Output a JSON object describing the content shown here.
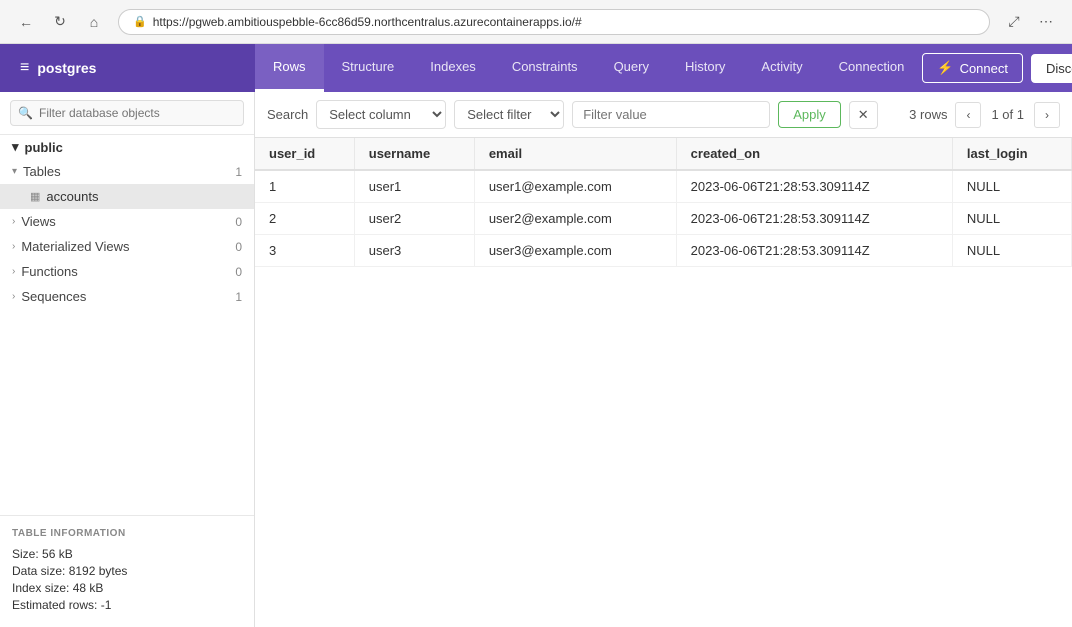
{
  "browser": {
    "url": "https://pgweb.ambitiouspebble-6cc86d59.northcentralus.azurecontainerapps.io/#",
    "back_btn": "←",
    "refresh_btn": "↻",
    "home_btn": "⌂"
  },
  "app": {
    "logo_icon": "≡",
    "logo_text": "postgres",
    "connect_label": "Connect",
    "disconnect_label": "Disconnect",
    "connect_icon": "⚡"
  },
  "nav_tabs": [
    {
      "id": "rows",
      "label": "Rows",
      "active": true
    },
    {
      "id": "structure",
      "label": "Structure",
      "active": false
    },
    {
      "id": "indexes",
      "label": "Indexes",
      "active": false
    },
    {
      "id": "constraints",
      "label": "Constraints",
      "active": false
    },
    {
      "id": "query",
      "label": "Query",
      "active": false
    },
    {
      "id": "history",
      "label": "History",
      "active": false
    },
    {
      "id": "activity",
      "label": "Activity",
      "active": false
    },
    {
      "id": "connection",
      "label": "Connection",
      "active": false
    }
  ],
  "sidebar": {
    "filter_placeholder": "Filter database objects",
    "schema_label": "public",
    "groups": [
      {
        "id": "tables",
        "label": "Tables",
        "count": 1,
        "expanded": true
      },
      {
        "id": "views",
        "label": "Views",
        "count": 0,
        "expanded": false
      },
      {
        "id": "materialized_views",
        "label": "Materialized Views",
        "count": 0,
        "expanded": false
      },
      {
        "id": "functions",
        "label": "Functions",
        "count": 0,
        "expanded": false
      },
      {
        "id": "sequences",
        "label": "Sequences",
        "count": 1,
        "expanded": false
      }
    ],
    "tables": [
      {
        "id": "accounts",
        "label": "accounts",
        "active": true
      }
    ]
  },
  "filter_bar": {
    "search_label": "Search",
    "column_placeholder": "Select column",
    "filter_placeholder": "Select filter",
    "value_placeholder": "Filter value",
    "apply_label": "Apply",
    "rows_count": "3 rows",
    "page_info": "1 of 1"
  },
  "table": {
    "columns": [
      "user_id",
      "username",
      "email",
      "created_on",
      "last_login"
    ],
    "rows": [
      {
        "user_id": "1",
        "username": "user1",
        "email": "user1@example.com",
        "created_on": "2023-06-06T21:28:53.309114Z",
        "last_login": "NULL"
      },
      {
        "user_id": "2",
        "username": "user2",
        "email": "user2@example.com",
        "created_on": "2023-06-06T21:28:53.309114Z",
        "last_login": "NULL"
      },
      {
        "user_id": "3",
        "username": "user3",
        "email": "user3@example.com",
        "created_on": "2023-06-06T21:28:53.309114Z",
        "last_login": "NULL"
      }
    ]
  },
  "table_info": {
    "title": "TABLE INFORMATION",
    "size_label": "Size:",
    "size_value": "56 kB",
    "data_size_label": "Data size:",
    "data_size_value": "8192 bytes",
    "index_size_label": "Index size:",
    "index_size_value": "48 kB",
    "estimated_rows_label": "Estimated rows:",
    "estimated_rows_value": "-1"
  }
}
